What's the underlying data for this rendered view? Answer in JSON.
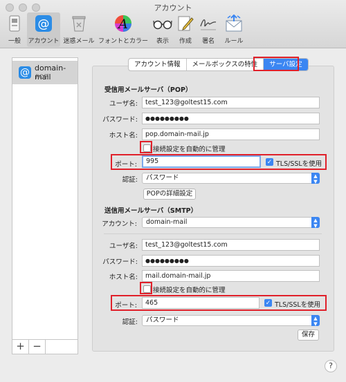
{
  "window": {
    "title": "アカウント"
  },
  "toolbar": {
    "items": [
      {
        "label": "一般",
        "icon": "general-icon"
      },
      {
        "label": "アカウント",
        "icon": "at-sign-icon"
      },
      {
        "label": "迷惑メール",
        "icon": "junk-mail-icon"
      },
      {
        "label": "フォントとカラー",
        "icon": "fonts-colors-icon"
      },
      {
        "label": "表示",
        "icon": "glasses-icon"
      },
      {
        "label": "作成",
        "icon": "compose-icon"
      },
      {
        "label": "署名",
        "icon": "signature-icon"
      },
      {
        "label": "ルール",
        "icon": "rules-icon"
      }
    ]
  },
  "sidebar": {
    "account": {
      "name": "domain-mail",
      "type": "POP",
      "icon_glyph": "@"
    },
    "add_label": "+",
    "remove_label": "−"
  },
  "tabs": [
    {
      "label": "アカウント情報"
    },
    {
      "label": "メールボックスの特性"
    },
    {
      "label": "サーバ設定"
    }
  ],
  "incoming": {
    "title": "受信用メールサーバ（POP）",
    "username_label": "ユーザ名:",
    "username": "test_123@goltest15.com",
    "password_label": "パスワード:",
    "password": "●●●●●●●●●",
    "host_label": "ホスト名:",
    "host": "pop.domain-mail.jp",
    "auto_label": "接続設定を自動的に管理",
    "port_label": "ポート:",
    "port": "995",
    "tls_label": "TLS/SSLを使用",
    "auth_label": "認証:",
    "auth": "パスワード",
    "advanced_label": "POPの詳細設定"
  },
  "outgoing": {
    "title": "送信用メールサーバ（SMTP）",
    "account_label": "アカウント:",
    "account": "domain-mail",
    "username_label": "ユーザ名:",
    "username": "test_123@goltest15.com",
    "password_label": "パスワード:",
    "password": "●●●●●●●●●",
    "host_label": "ホスト名:",
    "host": "mail.domain-mail.jp",
    "auto_label": "接続設定を自動的に管理",
    "port_label": "ポート:",
    "port": "465",
    "tls_label": "TLS/SSLを使用",
    "auth_label": "認証:",
    "auth": "パスワード",
    "save_label": "保存"
  },
  "help_label": "?",
  "colors": {
    "accent": "#3b86f2",
    "highlight": "#e0202a"
  }
}
